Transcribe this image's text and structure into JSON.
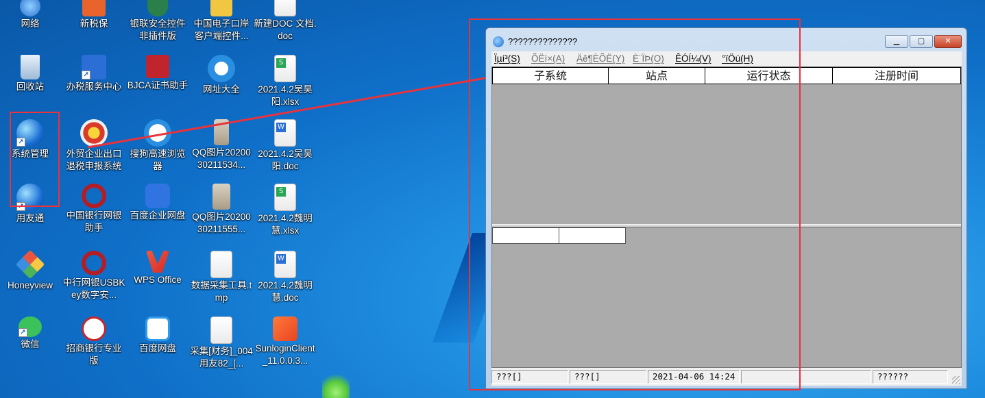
{
  "desktop": {
    "icons": [
      {
        "label": "网络",
        "icon": "network-icon"
      },
      {
        "label": "新税保",
        "icon": "app-icon"
      },
      {
        "label": "银联安全控件非插件版",
        "icon": "shield-icon"
      },
      {
        "label": "中国电子口岸客户端控件...",
        "icon": "app-icon"
      },
      {
        "label": "新建DOC 文档.doc",
        "icon": "doc-file-icon"
      },
      {
        "label": "回收站",
        "icon": "recycle-bin-icon"
      },
      {
        "label": "办税服务中心",
        "icon": "tax-service-icon"
      },
      {
        "label": "BJCA证书助手",
        "icon": "certificate-icon"
      },
      {
        "label": "网址大全",
        "icon": "browser-icon"
      },
      {
        "label": "2021.4.2吴昊阳.xlsx",
        "icon": "xlsx-file-icon"
      },
      {
        "label": "系统管理",
        "icon": "system-admin-icon"
      },
      {
        "label": "外贸企业出口退税申报系统",
        "icon": "tax-refund-icon"
      },
      {
        "label": "搜狗高速浏览器",
        "icon": "sogou-browser-icon"
      },
      {
        "label": "QQ图片2020030211534...",
        "icon": "image-file-icon"
      },
      {
        "label": "2021.4.2吴昊阳.doc",
        "icon": "doc-file-icon"
      },
      {
        "label": "用友通",
        "icon": "yonyou-icon"
      },
      {
        "label": "中国银行网银助手",
        "icon": "bank-of-china-icon"
      },
      {
        "label": "百度企业网盘",
        "icon": "baidu-pan-icon"
      },
      {
        "label": "QQ图片2020030211555...",
        "icon": "image-file-icon"
      },
      {
        "label": "2021.4.2魏明慧.xlsx",
        "icon": "xlsx-file-icon"
      },
      {
        "label": "Honeyview",
        "icon": "honeyview-icon"
      },
      {
        "label": "中行网银USBKey数字安...",
        "icon": "bank-of-china-icon"
      },
      {
        "label": "WPS Office",
        "icon": "wps-icon"
      },
      {
        "label": "数据采集工具.tmp",
        "icon": "blank-file-icon"
      },
      {
        "label": "2021.4.2魏明慧.doc",
        "icon": "doc-file-icon"
      },
      {
        "label": "微信",
        "icon": "wechat-icon"
      },
      {
        "label": "招商银行专业版",
        "icon": "cmb-icon"
      },
      {
        "label": "百度网盘",
        "icon": "baidu-pan-icon"
      },
      {
        "label": "采集[财务]_004用友82_[...",
        "icon": "config-file-icon"
      },
      {
        "label": "SunloginClient_11.0.0.3...",
        "icon": "sunlogin-icon"
      }
    ]
  },
  "window": {
    "title": "??????????????",
    "menus": [
      {
        "label": "Ïµí³(S)",
        "dim": false
      },
      {
        "label": "ÕËì×(A)",
        "dim": true
      },
      {
        "label": "Äê¶ÈÕË(Y)",
        "dim": true
      },
      {
        "label": "È¨ÏÞ(O)",
        "dim": true
      },
      {
        "label": "ÊÓÍ¼(V)",
        "dim": false
      },
      {
        "label": "°ïÖú(H)",
        "dim": false
      }
    ],
    "columns": [
      "子系统",
      "站点",
      "运行状态",
      "注册时间"
    ],
    "status": [
      "???[]",
      "???[]",
      "2021-04-06 14:24",
      "",
      "??????"
    ]
  },
  "colors": {
    "annotation": "#e8333c",
    "desktop": "#1f8ee0"
  }
}
